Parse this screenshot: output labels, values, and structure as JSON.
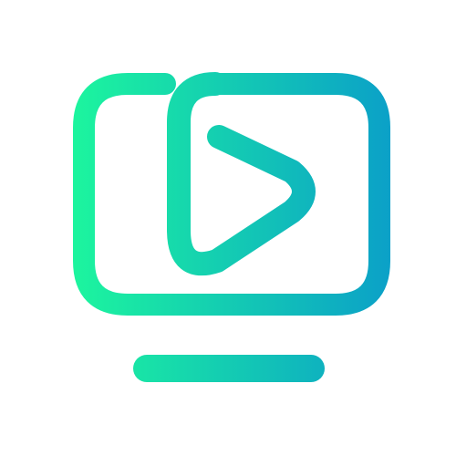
{
  "logo": {
    "icon": "monitor-play-icon",
    "gradient_start": "#1CF59E",
    "gradient_end": "#0BA0C8"
  }
}
